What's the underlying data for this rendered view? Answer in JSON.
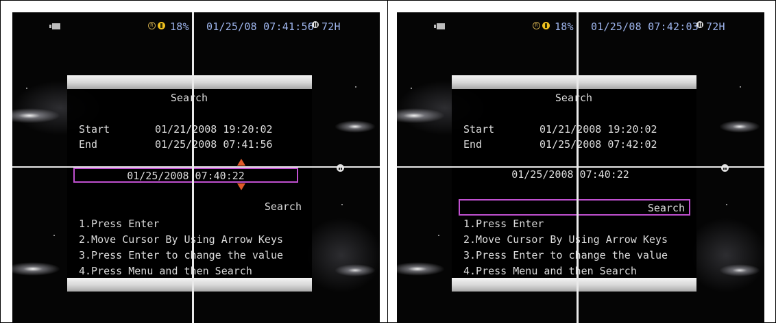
{
  "screens": [
    {
      "status": {
        "percent": "18%",
        "datetime": "01/25/08 07:41:56",
        "hours": "72H"
      },
      "panel": {
        "title": "Search",
        "start_label": "Start",
        "start_value": "01/21/2008 19:20:02",
        "end_label": "End",
        "end_value": "01/25/2008 07:41:56",
        "edit_value": "01/25/2008 07:40:22",
        "search_label": "Search",
        "instructions": [
          "1.Press Enter",
          "2.Move Cursor By Using Arrow Keys",
          "3.Press Enter to change the value",
          "4.Press Menu and then Search"
        ]
      },
      "focus": "edit"
    },
    {
      "status": {
        "percent": "18%",
        "datetime": "01/25/08 07:42:03",
        "hours": "72H"
      },
      "panel": {
        "title": "Search",
        "start_label": "Start",
        "start_value": "01/21/2008 19:20:02",
        "end_label": "End",
        "end_value": "01/25/2008 07:42:02",
        "edit_value": "01/25/2008 07:40:22",
        "search_label": "Search",
        "instructions": [
          "1.Press Enter",
          "2.Move Cursor By Using Arrow Keys",
          "3.Press Enter to change the value",
          "4.Press Menu and then Search"
        ]
      },
      "focus": "search"
    }
  ],
  "colors": {
    "status_text": "#9fb6ee",
    "focus_border": "#c050d0",
    "arrow": "#e05a2a",
    "text": "#dcdcdc"
  }
}
